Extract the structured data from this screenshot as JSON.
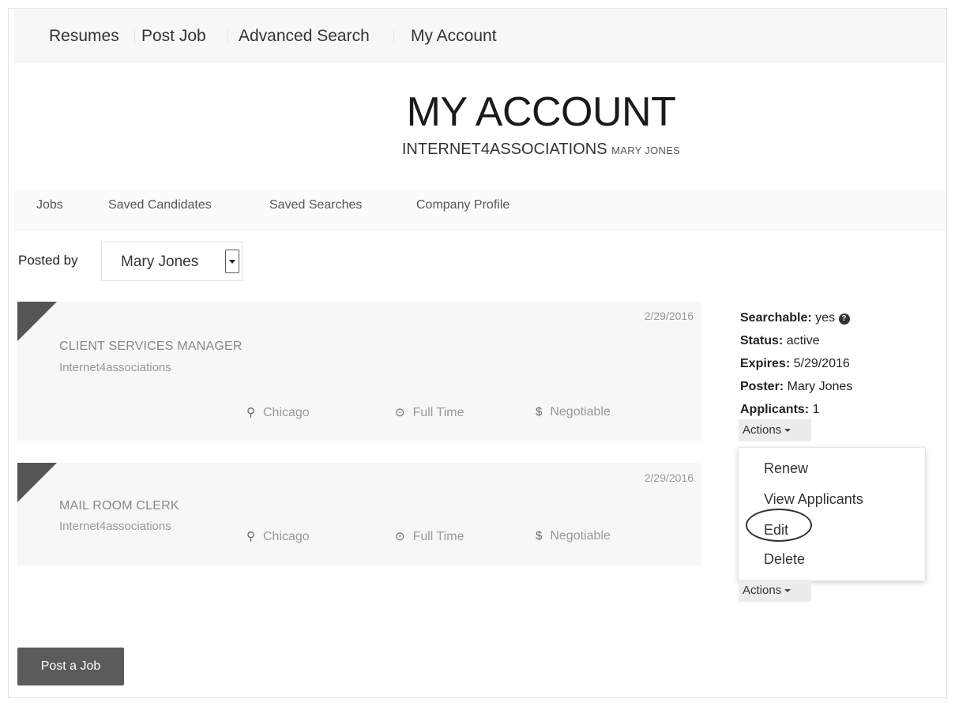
{
  "nav": {
    "items": [
      "Resumes",
      "Post Job",
      "Advanced Search",
      "My Account"
    ]
  },
  "header": {
    "title": "MY ACCOUNT",
    "company": "INTERNET4ASSOCIATIONS",
    "user": "MARY JONES"
  },
  "tabs": [
    "Jobs",
    "Saved Candidates",
    "Saved Searches",
    "Company Profile"
  ],
  "filter": {
    "label": "Posted by",
    "value": "Mary Jones"
  },
  "jobs": [
    {
      "date": "2/29/2016",
      "title": "CLIENT SERVICES MANAGER",
      "company": "Internet4associations",
      "location": "Chicago",
      "type": "Full Time",
      "salary": "Negotiable"
    },
    {
      "date": "2/29/2016",
      "title": "MAIL ROOM CLERK",
      "company": "Internet4associations",
      "location": "Chicago",
      "type": "Full Time",
      "salary": "Negotiable"
    }
  ],
  "details": {
    "searchable_label": "Searchable:",
    "searchable_value": "yes",
    "status_label": "Status:",
    "status_value": "active",
    "expires_label": "Expires:",
    "expires_value": "5/29/2016",
    "poster_label": "Poster:",
    "poster_value": "Mary Jones",
    "applicants_label": "Applicants:",
    "applicants_value": "1"
  },
  "actions_label": "Actions",
  "menu": [
    "Renew",
    "View Applicants",
    "Edit",
    "Delete"
  ],
  "post_button": "Post a Job",
  "icons": {
    "location": "map-marker-icon",
    "type": "clock-icon",
    "salary": "dollar-icon",
    "help": "question-circle-icon"
  }
}
